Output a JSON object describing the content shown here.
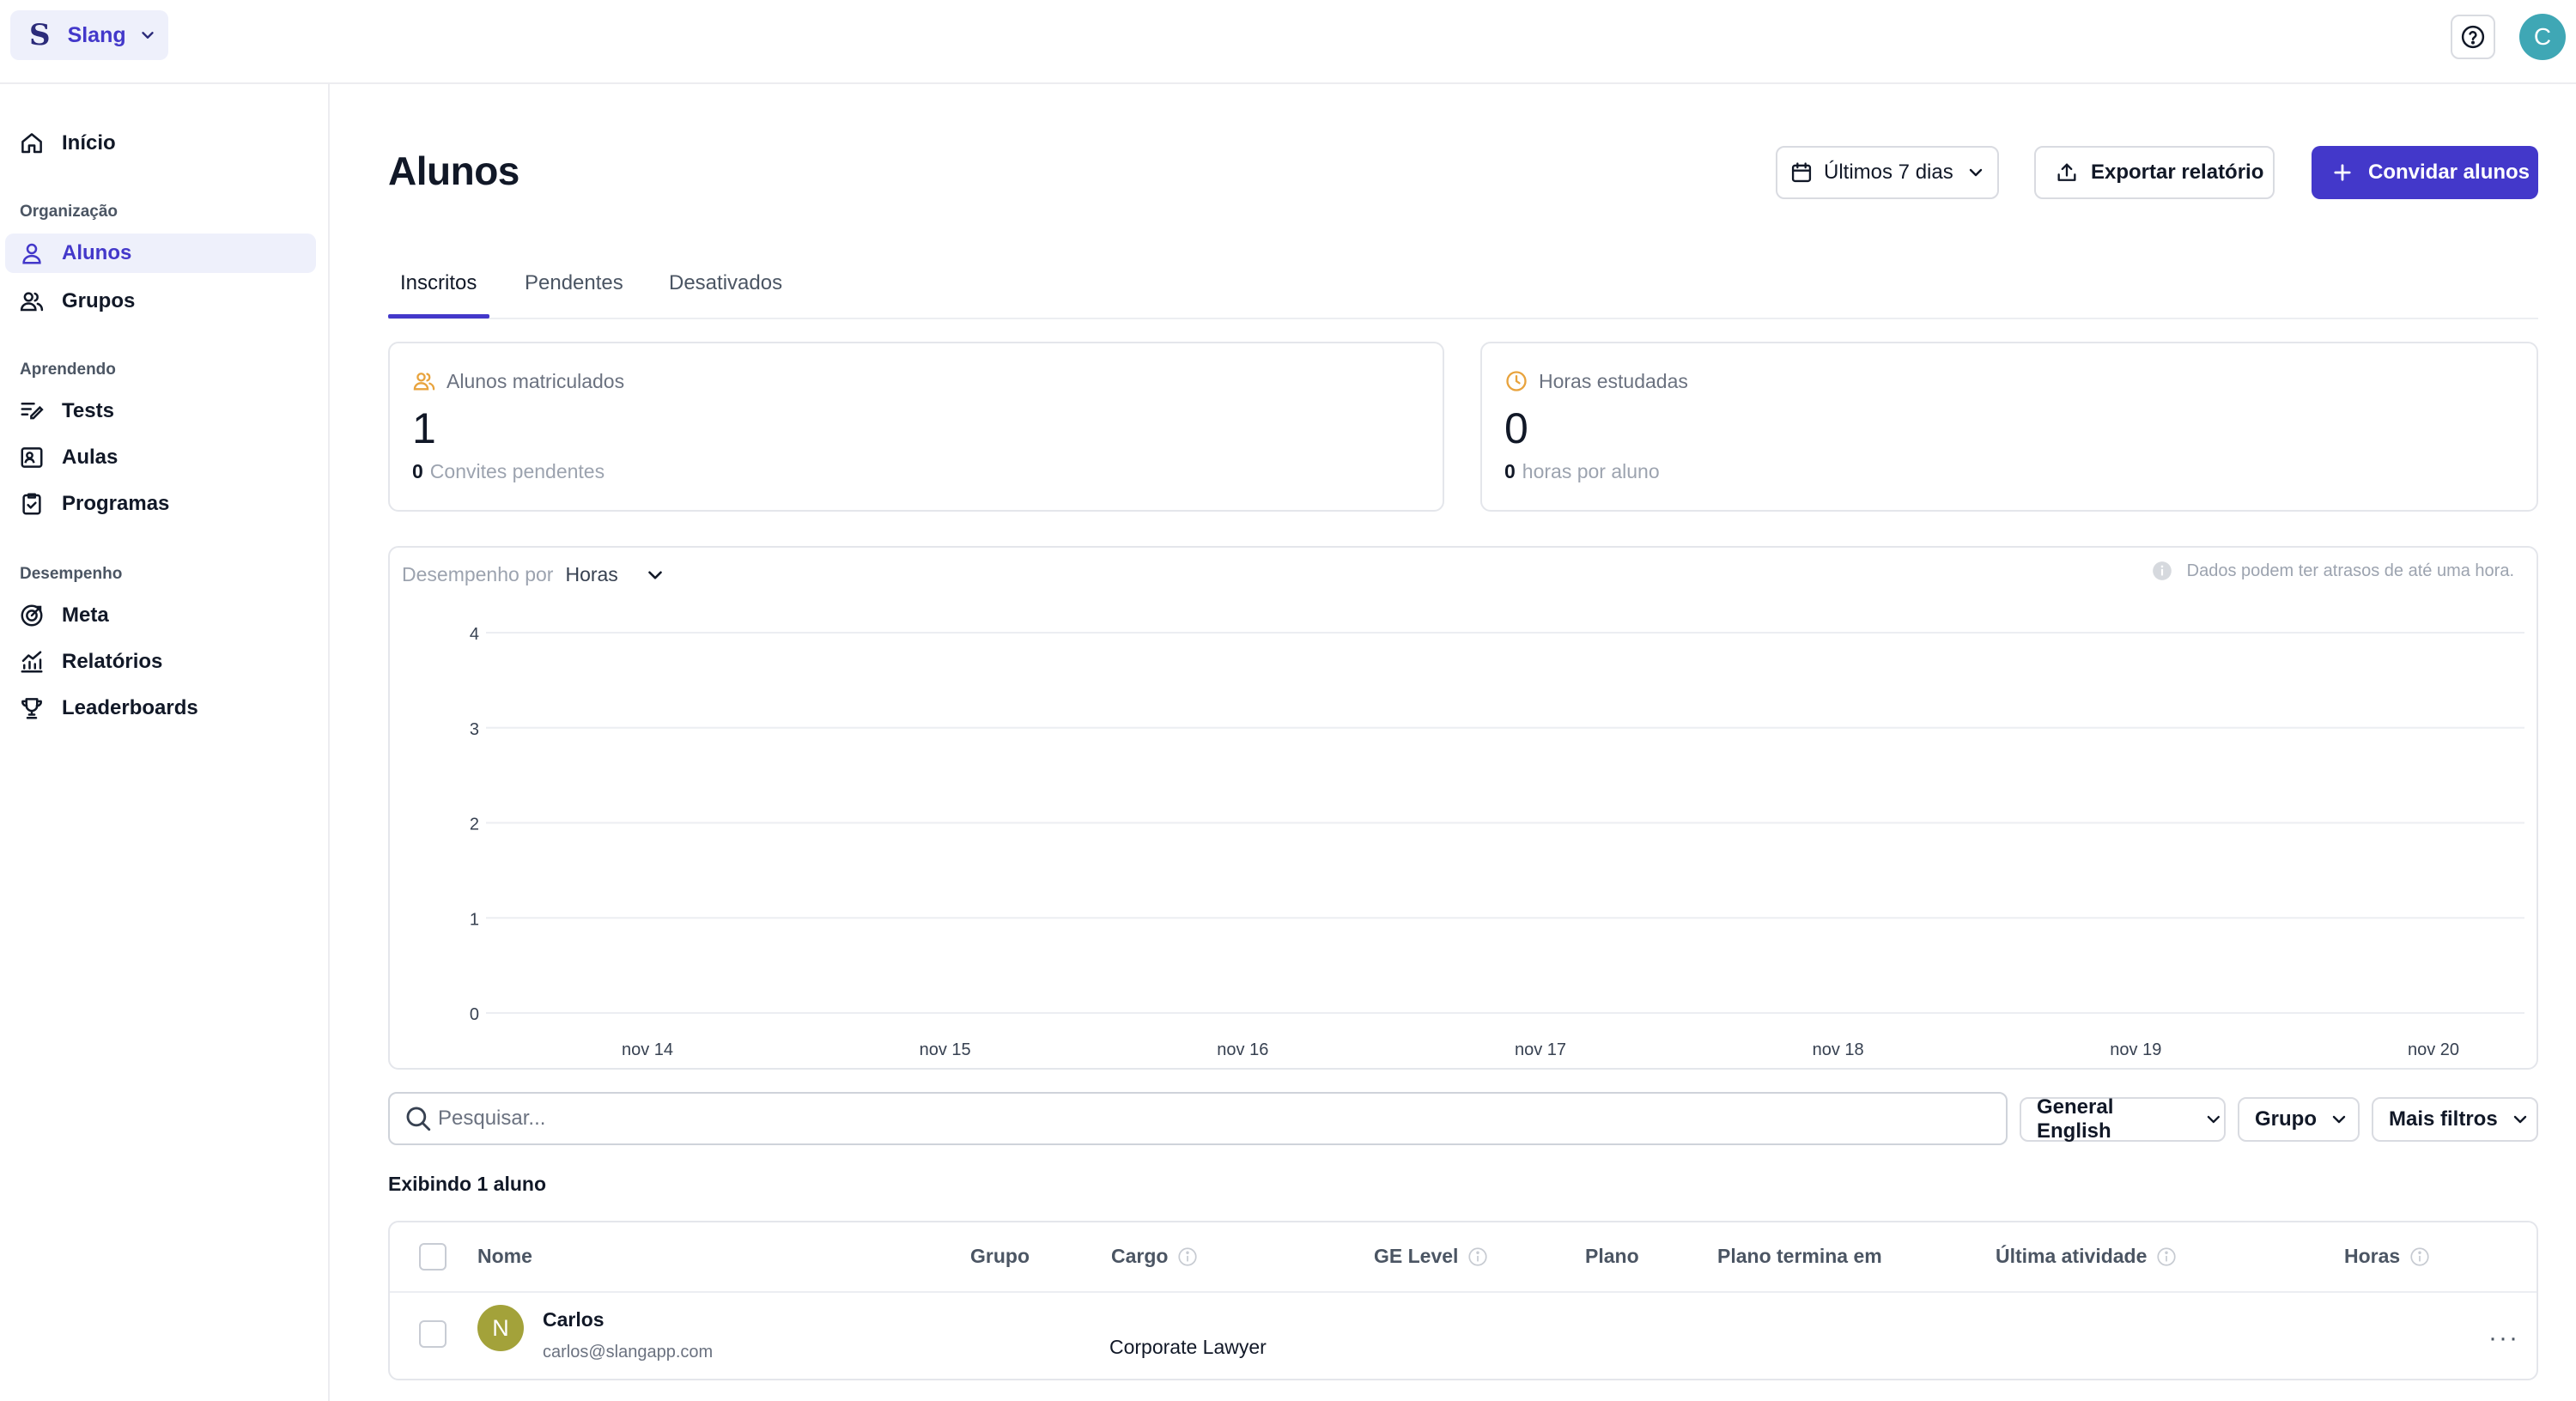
{
  "org": {
    "logo": "S",
    "name": "Slang"
  },
  "user": {
    "initial": "C"
  },
  "sidebar": {
    "home": "Início",
    "sections": [
      {
        "title": "Organização",
        "items": [
          "Alunos",
          "Grupos"
        ]
      },
      {
        "title": "Aprendendo",
        "items": [
          "Tests",
          "Aulas",
          "Programas"
        ]
      },
      {
        "title": "Desempenho",
        "items": [
          "Meta",
          "Relatórios",
          "Leaderboards"
        ]
      }
    ],
    "active": "Alunos"
  },
  "page": {
    "title": "Alunos",
    "date_range": "Últimos 7 dias",
    "export_label": "Exportar relatório",
    "invite_label": "Convidar alunos"
  },
  "tabs": [
    "Inscritos",
    "Pendentes",
    "Desativados"
  ],
  "stats": {
    "enrolled": {
      "label": "Alunos matriculados",
      "value": "1",
      "sub_value": "0",
      "sub_label": "Convites pendentes"
    },
    "hours": {
      "label": "Horas estudadas",
      "value": "0",
      "sub_value": "0",
      "sub_label": "horas por aluno"
    }
  },
  "performance": {
    "by_label": "Desempenho por",
    "selected": "Horas",
    "note": "Dados podem ter atrasos de até uma hora."
  },
  "chart_data": {
    "type": "line",
    "x": [
      "nov 14",
      "nov 15",
      "nov 16",
      "nov 17",
      "nov 18",
      "nov 19",
      "nov 20"
    ],
    "series": [
      {
        "values": [
          0,
          0,
          0,
          0,
          0,
          0,
          0
        ]
      }
    ],
    "y_ticks": [
      "0",
      "1",
      "2",
      "3",
      "4"
    ],
    "ylim": [
      0,
      4
    ],
    "grid": true
  },
  "filters": {
    "search_placeholder": "Pesquisar...",
    "course": "General English",
    "group": "Grupo",
    "more": "Mais filtros"
  },
  "table": {
    "showing": "Exibindo 1 aluno",
    "columns": {
      "name": "Nome",
      "group": "Grupo",
      "role": "Cargo",
      "ge_level": "GE Level",
      "plan": "Plano",
      "plan_ends": "Plano termina em",
      "last_activity": "Última atividade",
      "hours": "Horas"
    },
    "rows": [
      {
        "initial": "N",
        "name": "Carlos",
        "email": "carlos@slangapp.com",
        "role": "Corporate Lawyer",
        "more": "···"
      }
    ]
  },
  "colors": {
    "accent": "#4338ca",
    "accent_bg": "#eef0fb",
    "icon_orange": "#e8a33d",
    "avatar_teal": "#3fa7b5",
    "avatar_olive": "#a3a23a"
  }
}
